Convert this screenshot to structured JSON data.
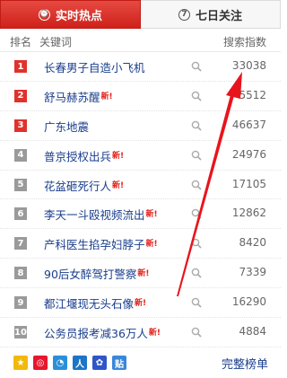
{
  "tabs": {
    "realtime_label": "实时热点",
    "weekly_label": "七日关注"
  },
  "header": {
    "rank_col": "排名",
    "keyword_col": "关键词",
    "index_col": "搜索指数"
  },
  "rows": [
    {
      "rank": "1",
      "keyword": "长春男子自造小飞机",
      "is_new": false,
      "value": "33038"
    },
    {
      "rank": "2",
      "keyword": "舒马赫苏醒",
      "is_new": true,
      "value": "5512"
    },
    {
      "rank": "3",
      "keyword": "广东地震",
      "is_new": false,
      "value": "46637"
    },
    {
      "rank": "4",
      "keyword": "普京授权出兵",
      "is_new": true,
      "value": "24976"
    },
    {
      "rank": "5",
      "keyword": "花盆砸死行人",
      "is_new": true,
      "value": "17105"
    },
    {
      "rank": "6",
      "keyword": "李天一斗殴视频流出",
      "is_new": true,
      "value": "12862"
    },
    {
      "rank": "7",
      "keyword": "产科医生掐孕妇脖子",
      "is_new": true,
      "value": "8420"
    },
    {
      "rank": "8",
      "keyword": "90后女醉驾打警察",
      "is_new": true,
      "value": "7339"
    },
    {
      "rank": "9",
      "keyword": "都江堰现无头石像",
      "is_new": true,
      "value": "16290"
    },
    {
      "rank": "10",
      "keyword": "公务员报考减36万人",
      "is_new": true,
      "value": "4884"
    }
  ],
  "new_badge": "新!",
  "footer": {
    "more_label": "完整榜单",
    "icons": [
      "qzone-icon",
      "weibo-icon",
      "qq-icon",
      "renren-icon",
      "baidu-icon",
      "tieba-icon"
    ]
  },
  "colors": {
    "accent": "#e0322c",
    "link": "#1a3e8c"
  }
}
